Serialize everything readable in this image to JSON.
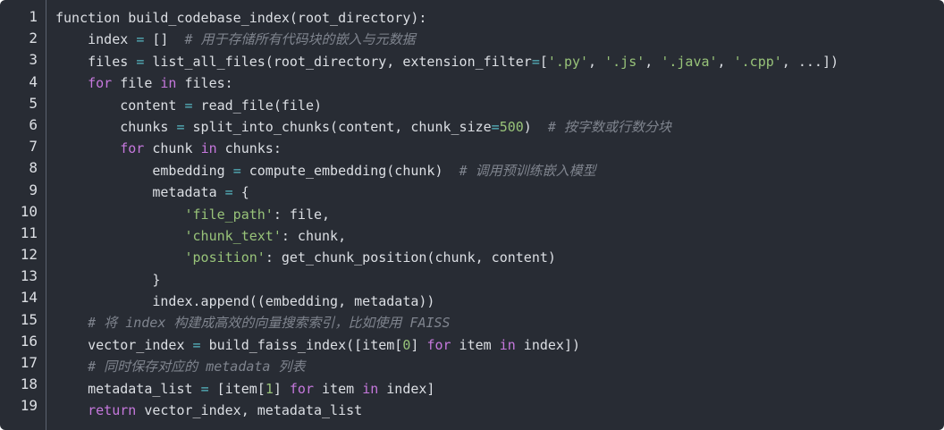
{
  "code": {
    "lines": [
      {
        "number": "1",
        "tokens": [
          {
            "t": "function build_codebase_index(root_directory):",
            "k": "plain"
          }
        ]
      },
      {
        "number": "2",
        "tokens": [
          {
            "t": "    index ",
            "k": "plain"
          },
          {
            "t": "=",
            "k": "op"
          },
          {
            "t": " []  ",
            "k": "plain"
          },
          {
            "t": "# 用于存储所有代码块的嵌入与元数据",
            "k": "comment"
          }
        ]
      },
      {
        "number": "3",
        "tokens": [
          {
            "t": "    files ",
            "k": "plain"
          },
          {
            "t": "=",
            "k": "op"
          },
          {
            "t": " list_all_files(root_directory, extension_filter",
            "k": "plain"
          },
          {
            "t": "=",
            "k": "op"
          },
          {
            "t": "[",
            "k": "plain"
          },
          {
            "t": "'.py'",
            "k": "string"
          },
          {
            "t": ", ",
            "k": "plain"
          },
          {
            "t": "'.js'",
            "k": "string"
          },
          {
            "t": ", ",
            "k": "plain"
          },
          {
            "t": "'.java'",
            "k": "string"
          },
          {
            "t": ", ",
            "k": "plain"
          },
          {
            "t": "'.cpp'",
            "k": "string"
          },
          {
            "t": ", ...])",
            "k": "plain"
          }
        ]
      },
      {
        "number": "4",
        "tokens": [
          {
            "t": "    ",
            "k": "plain"
          },
          {
            "t": "for",
            "k": "keyword"
          },
          {
            "t": " file ",
            "k": "plain"
          },
          {
            "t": "in",
            "k": "keyword"
          },
          {
            "t": " files:",
            "k": "plain"
          }
        ]
      },
      {
        "number": "5",
        "tokens": [
          {
            "t": "        content ",
            "k": "plain"
          },
          {
            "t": "=",
            "k": "op"
          },
          {
            "t": " read_file(file)",
            "k": "plain"
          }
        ]
      },
      {
        "number": "6",
        "tokens": [
          {
            "t": "        chunks ",
            "k": "plain"
          },
          {
            "t": "=",
            "k": "op"
          },
          {
            "t": " split_into_chunks(content, chunk_size",
            "k": "plain"
          },
          {
            "t": "=",
            "k": "op"
          },
          {
            "t": "500",
            "k": "number"
          },
          {
            "t": ")  ",
            "k": "plain"
          },
          {
            "t": "# 按字数或行数分块",
            "k": "comment"
          }
        ]
      },
      {
        "number": "7",
        "tokens": [
          {
            "t": "        ",
            "k": "plain"
          },
          {
            "t": "for",
            "k": "keyword"
          },
          {
            "t": " chunk ",
            "k": "plain"
          },
          {
            "t": "in",
            "k": "keyword"
          },
          {
            "t": " chunks:",
            "k": "plain"
          }
        ]
      },
      {
        "number": "8",
        "tokens": [
          {
            "t": "            embedding ",
            "k": "plain"
          },
          {
            "t": "=",
            "k": "op"
          },
          {
            "t": " compute_embedding(chunk)  ",
            "k": "plain"
          },
          {
            "t": "# 调用预训练嵌入模型",
            "k": "comment"
          }
        ]
      },
      {
        "number": "9",
        "tokens": [
          {
            "t": "            metadata ",
            "k": "plain"
          },
          {
            "t": "=",
            "k": "op"
          },
          {
            "t": " {",
            "k": "plain"
          }
        ]
      },
      {
        "number": "10",
        "tokens": [
          {
            "t": "                ",
            "k": "plain"
          },
          {
            "t": "'file_path'",
            "k": "string"
          },
          {
            "t": ": file,",
            "k": "plain"
          }
        ]
      },
      {
        "number": "11",
        "tokens": [
          {
            "t": "                ",
            "k": "plain"
          },
          {
            "t": "'chunk_text'",
            "k": "string"
          },
          {
            "t": ": chunk,",
            "k": "plain"
          }
        ]
      },
      {
        "number": "12",
        "tokens": [
          {
            "t": "                ",
            "k": "plain"
          },
          {
            "t": "'position'",
            "k": "string"
          },
          {
            "t": ": get_chunk_position(chunk, content)",
            "k": "plain"
          }
        ]
      },
      {
        "number": "13",
        "tokens": [
          {
            "t": "            }",
            "k": "plain"
          }
        ]
      },
      {
        "number": "14",
        "tokens": [
          {
            "t": "            index.append((embedding, metadata))",
            "k": "plain"
          }
        ]
      },
      {
        "number": "15",
        "tokens": [
          {
            "t": "    ",
            "k": "plain"
          },
          {
            "t": "# 将 index 构建成高效的向量搜索索引，比如使用 FAISS",
            "k": "comment"
          }
        ]
      },
      {
        "number": "16",
        "tokens": [
          {
            "t": "    vector_index ",
            "k": "plain"
          },
          {
            "t": "=",
            "k": "op"
          },
          {
            "t": " build_faiss_index([item[",
            "k": "plain"
          },
          {
            "t": "0",
            "k": "number"
          },
          {
            "t": "] ",
            "k": "plain"
          },
          {
            "t": "for",
            "k": "keyword"
          },
          {
            "t": " item ",
            "k": "plain"
          },
          {
            "t": "in",
            "k": "keyword"
          },
          {
            "t": " index])",
            "k": "plain"
          }
        ]
      },
      {
        "number": "17",
        "tokens": [
          {
            "t": "    ",
            "k": "plain"
          },
          {
            "t": "# 同时保存对应的 metadata 列表",
            "k": "comment"
          }
        ]
      },
      {
        "number": "18",
        "tokens": [
          {
            "t": "    metadata_list ",
            "k": "plain"
          },
          {
            "t": "=",
            "k": "op"
          },
          {
            "t": " [item[",
            "k": "plain"
          },
          {
            "t": "1",
            "k": "number"
          },
          {
            "t": "] ",
            "k": "plain"
          },
          {
            "t": "for",
            "k": "keyword"
          },
          {
            "t": " item ",
            "k": "plain"
          },
          {
            "t": "in",
            "k": "keyword"
          },
          {
            "t": " index]",
            "k": "plain"
          }
        ]
      },
      {
        "number": "19",
        "tokens": [
          {
            "t": "    ",
            "k": "plain"
          },
          {
            "t": "return",
            "k": "keyword"
          },
          {
            "t": " vector_index, metadata_list",
            "k": "plain"
          }
        ]
      }
    ]
  },
  "colors": {
    "background": "#282c34",
    "text": "#dcdfe4",
    "keyword": "#c678dd",
    "string": "#98c379",
    "comment": "#7f848e",
    "operator": "#56b6c2"
  }
}
